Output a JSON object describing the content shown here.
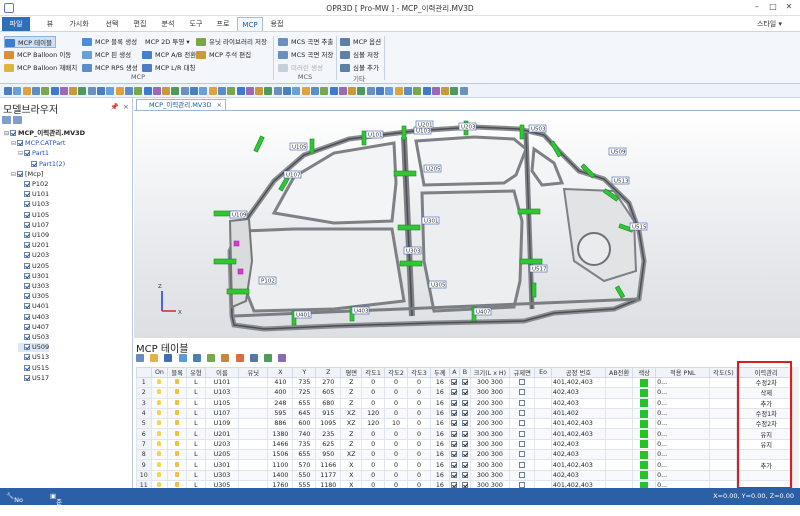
{
  "window": {
    "title": "OPR3D [ Pro-MW ] - MCP_이력관리.MV3D",
    "minimize": "–",
    "maximize": "□",
    "close": "✕"
  },
  "menu": {
    "file": "파일",
    "tabs": [
      "뷰",
      "가시화",
      "선택",
      "편집",
      "분석",
      "도구",
      "프로",
      "MCP",
      "용접"
    ],
    "active_tab": "MCP",
    "style": "스타일"
  },
  "ribbon": {
    "mcp_group": {
      "label": "MCP",
      "buttons": [
        "MCP 테이블",
        "MCP Balloon 이동",
        "MCP Balloon 재배치",
        "MCP 블록 생성",
        "MCP 핀 생성",
        "MCP RPS 생성",
        "MCP 2D 투영",
        "MCP A/B 전환",
        "MCP L/R 대칭",
        "유닛 라이브러리 저장",
        "MCP 주석 편집"
      ]
    },
    "mcs_group": {
      "label": "MCS",
      "buttons": [
        "MCS 곡면 추출",
        "MCS 곡면 저장",
        "미러린 생성"
      ]
    },
    "etc_group": {
      "label": "기타",
      "buttons": [
        "MCP 옵션",
        "심볼 저장",
        "심볼 추가"
      ]
    }
  },
  "model_browser": {
    "title": "모델브라우저",
    "pin": "📌",
    "close": "×",
    "tree": [
      {
        "label": "MCP_이력관리.MV3D",
        "level": 0,
        "bold": true
      },
      {
        "label": "MCP.CATPart",
        "level": 1,
        "blue": true
      },
      {
        "label": "Part1",
        "level": 2,
        "blue": true
      },
      {
        "label": "Part1(2)",
        "level": 3,
        "blue": true
      },
      {
        "label": "[Mcp]",
        "level": 1
      },
      {
        "label": "P102",
        "level": 2
      },
      {
        "label": "U101",
        "level": 2
      },
      {
        "label": "U103",
        "level": 2
      },
      {
        "label": "U105",
        "level": 2
      },
      {
        "label": "U107",
        "level": 2
      },
      {
        "label": "U109",
        "level": 2
      },
      {
        "label": "U201",
        "level": 2
      },
      {
        "label": "U203",
        "level": 2
      },
      {
        "label": "U205",
        "level": 2
      },
      {
        "label": "U301",
        "level": 2
      },
      {
        "label": "U303",
        "level": 2
      },
      {
        "label": "U305",
        "level": 2
      },
      {
        "label": "U401",
        "level": 2
      },
      {
        "label": "U403",
        "level": 2
      },
      {
        "label": "U407",
        "level": 2
      },
      {
        "label": "U503",
        "level": 2
      },
      {
        "label": "U509",
        "level": 2,
        "selected": true
      },
      {
        "label": "U513",
        "level": 2
      },
      {
        "label": "U515",
        "level": 2
      },
      {
        "label": "U517",
        "level": 2
      }
    ]
  },
  "viewport": {
    "tab_label": "MCP_이력관리.MV3D",
    "axis": {
      "x": "X",
      "y": "Y",
      "z": "Z"
    },
    "callouts": [
      "U101",
      "U103",
      "U105",
      "U107",
      "U109",
      "U201",
      "U203",
      "U205",
      "U301",
      "U303",
      "U305",
      "U401",
      "U403",
      "U407",
      "U503",
      "U509",
      "U513",
      "U515",
      "U517",
      "P102"
    ]
  },
  "mcp_table": {
    "title": "MCP 테이블",
    "columns": [
      "",
      "On",
      "블록",
      "유형",
      "이름",
      "유닛",
      "X",
      "Y",
      "Z",
      "평면",
      "각도1",
      "각도2",
      "각도3",
      "두께",
      "A",
      "B",
      "크기(L x H)",
      "규제면",
      "Eo",
      "공정 번호",
      "AB전환",
      "색상",
      "적용 PNL",
      "각도(5)",
      "이력관리"
    ],
    "rows": [
      {
        "n": "1",
        "type": "L",
        "name": "U101",
        "x": "410",
        "y": "735",
        "z": "270",
        "plane": "Z",
        "a1": "0",
        "a2": "0",
        "a3": "0",
        "t": "16",
        "a": true,
        "b": true,
        "size": "300",
        "size2": "300",
        "proc": "401,402,403",
        "pnl": "0...",
        "hist": "수정2차"
      },
      {
        "n": "2",
        "type": "L",
        "name": "U103",
        "x": "400",
        "y": "725",
        "z": "605",
        "plane": "Z",
        "a1": "0",
        "a2": "0",
        "a3": "0",
        "t": "16",
        "a": true,
        "b": true,
        "size": "300",
        "size2": "300",
        "proc": "402,403",
        "pnl": "0...",
        "hist": "삭제"
      },
      {
        "n": "3",
        "type": "L",
        "name": "U105",
        "x": "248",
        "y": "655",
        "z": "680",
        "plane": "Z",
        "a1": "0",
        "a2": "0",
        "a3": "0",
        "t": "16",
        "a": true,
        "b": true,
        "size": "200",
        "size2": "300",
        "proc": "402,403",
        "pnl": "0...",
        "hist": "추가"
      },
      {
        "n": "4",
        "type": "L",
        "name": "U107",
        "x": "595",
        "y": "645",
        "z": "915",
        "plane": "XZ",
        "a1": "120",
        "a2": "0",
        "a3": "0",
        "t": "16",
        "a": true,
        "b": true,
        "size": "200",
        "size2": "300",
        "proc": "401,402",
        "pnl": "0...",
        "hist": "수정1차"
      },
      {
        "n": "5",
        "type": "L",
        "name": "U109",
        "x": "886",
        "y": "600",
        "z": "1095",
        "plane": "XZ",
        "a1": "120",
        "a2": "10",
        "a3": "0",
        "t": "16",
        "a": true,
        "b": true,
        "size": "200",
        "size2": "300",
        "proc": "401,402,403",
        "pnl": "0...",
        "hist": "수정2차"
      },
      {
        "n": "6",
        "type": "L",
        "name": "U201",
        "x": "1380",
        "y": "740",
        "z": "235",
        "plane": "Z",
        "a1": "0",
        "a2": "0",
        "a3": "0",
        "t": "16",
        "a": true,
        "b": true,
        "size": "300",
        "size2": "300",
        "proc": "401,402,403",
        "pnl": "0...",
        "hist": "유지"
      },
      {
        "n": "7",
        "type": "L",
        "name": "U203",
        "x": "1466",
        "y": "735",
        "z": "625",
        "plane": "Z",
        "a1": "0",
        "a2": "0",
        "a3": "0",
        "t": "16",
        "a": true,
        "b": true,
        "size": "300",
        "size2": "300",
        "proc": "402,403",
        "pnl": "0...",
        "hist": "유지"
      },
      {
        "n": "8",
        "type": "L",
        "name": "U205",
        "x": "1506",
        "y": "655",
        "z": "950",
        "plane": "XZ",
        "a1": "0",
        "a2": "0",
        "a3": "0",
        "t": "16",
        "a": true,
        "b": true,
        "size": "200",
        "size2": "300",
        "proc": "402,403",
        "pnl": "0...",
        "hist": ""
      },
      {
        "n": "9",
        "type": "L",
        "name": "U301",
        "x": "1100",
        "y": "570",
        "z": "1166",
        "plane": "X",
        "a1": "0",
        "a2": "0",
        "a3": "0",
        "t": "16",
        "a": true,
        "b": true,
        "size": "300",
        "size2": "300",
        "proc": "401,402,403",
        "pnl": "0...",
        "hist": "추가"
      },
      {
        "n": "10",
        "type": "L",
        "name": "U303",
        "x": "1400",
        "y": "550",
        "z": "1177",
        "plane": "X",
        "a1": "0",
        "a2": "0",
        "a3": "0",
        "t": "16",
        "a": true,
        "b": true,
        "size": "300",
        "size2": "300",
        "proc": "402,403",
        "pnl": "0...",
        "hist": ""
      },
      {
        "n": "11",
        "type": "L",
        "name": "U305",
        "x": "1760",
        "y": "555",
        "z": "1180",
        "plane": "X",
        "a1": "0",
        "a2": "0",
        "a3": "0",
        "t": "16",
        "a": true,
        "b": true,
        "size": "300",
        "size2": "300",
        "proc": "401,402,403",
        "pnl": "0...",
        "hist": ""
      }
    ]
  },
  "status": {
    "left": "No Active",
    "mid": "준비",
    "coords": "X=0.00, Y=0.00, Z=0.00"
  },
  "colors": {
    "accent": "#2b5fa6",
    "mcp_green": "#22c428",
    "highlight_box": "#d81e1e"
  }
}
